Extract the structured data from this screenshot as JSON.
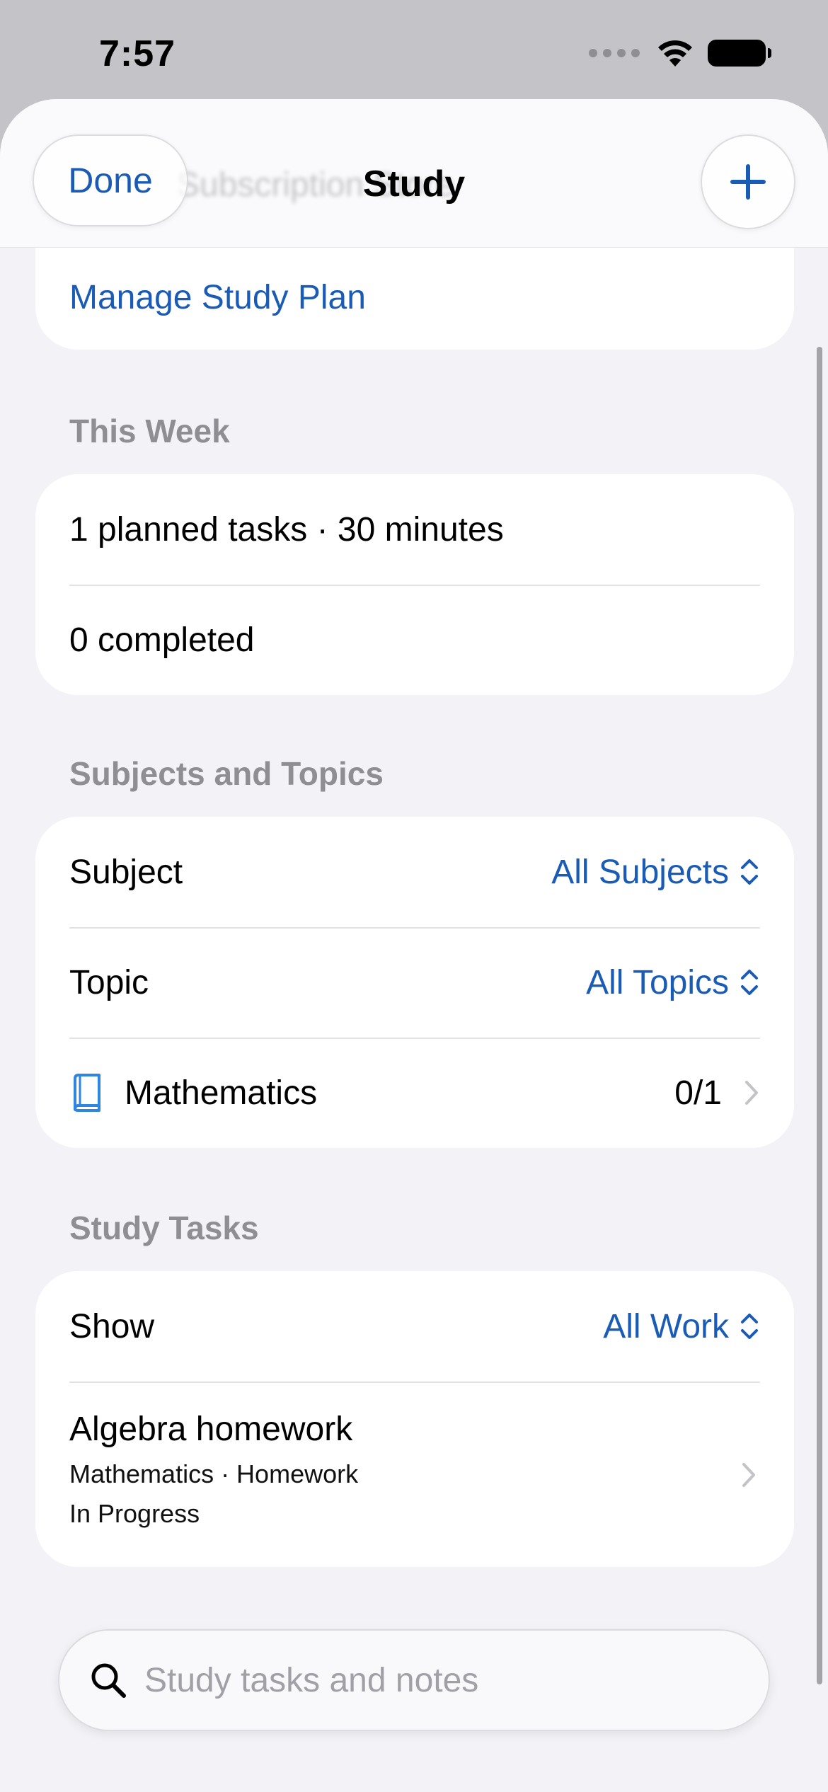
{
  "status_bar": {
    "time": "7:57"
  },
  "nav": {
    "back_label": "Done",
    "title": "Study",
    "ghost_text": "Subscription Store",
    "add_icon": "plus-icon"
  },
  "top_section": {
    "manage_label": "Manage Study Plan"
  },
  "this_week": {
    "header": "This Week",
    "planned": "1 planned tasks · 30 minutes",
    "completed": "0 completed"
  },
  "subjects": {
    "header": "Subjects and Topics",
    "subject_label": "Subject",
    "subject_value": "All Subjects",
    "topic_label": "Topic",
    "topic_value": "All Topics",
    "items": [
      {
        "name": "Mathematics",
        "progress": "0/1",
        "icon": "book-icon"
      }
    ]
  },
  "tasks": {
    "header": "Study Tasks",
    "show_label": "Show",
    "show_value": "All Work",
    "items": [
      {
        "title": "Algebra homework",
        "subtitle": "Mathematics · Homework",
        "status": "In Progress"
      }
    ]
  },
  "search": {
    "placeholder": "Study tasks and notes",
    "value": ""
  },
  "colors": {
    "accent": "#1a5bb5",
    "secondary_text": "#8e8e93",
    "background": "#f2f2f7"
  }
}
